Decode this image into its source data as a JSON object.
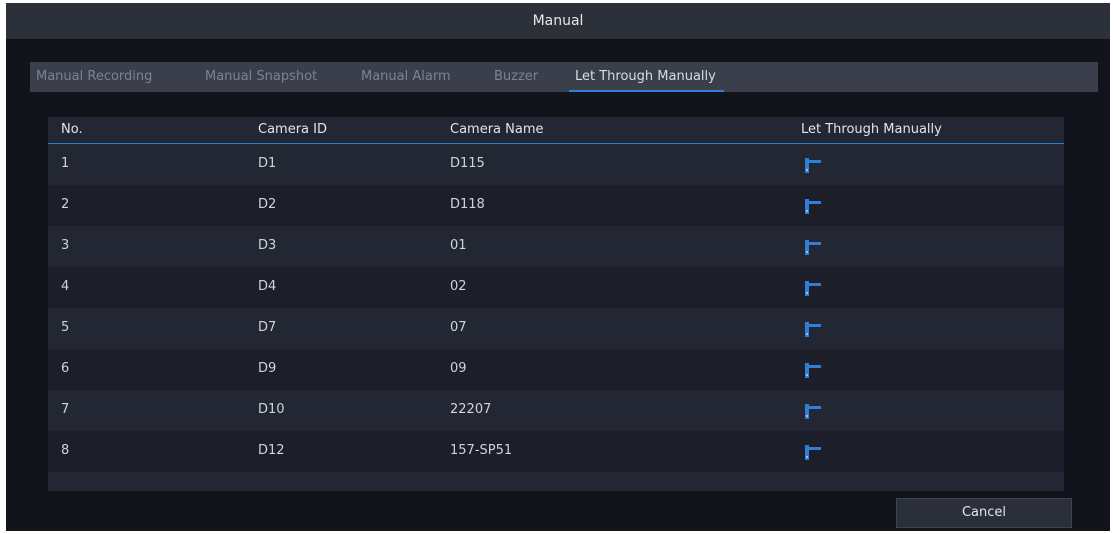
{
  "window": {
    "title": "Manual"
  },
  "tabs": [
    {
      "label": "Manual Recording"
    },
    {
      "label": "Manual Snapshot"
    },
    {
      "label": "Manual Alarm"
    },
    {
      "label": "Buzzer"
    },
    {
      "label": "Let Through Manually",
      "active": true
    }
  ],
  "table": {
    "headers": {
      "no": "No.",
      "camera_id": "Camera ID",
      "camera_name": "Camera Name",
      "action": "Let Through Manually"
    },
    "rows": [
      {
        "no": "1",
        "camera_id": "D1",
        "camera_name": "D115",
        "icon": "barrier-gate-icon"
      },
      {
        "no": "2",
        "camera_id": "D2",
        "camera_name": "D118",
        "icon": "barrier-gate-icon"
      },
      {
        "no": "3",
        "camera_id": "D3",
        "camera_name": "01",
        "icon": "barrier-gate-icon"
      },
      {
        "no": "4",
        "camera_id": "D4",
        "camera_name": "02",
        "icon": "barrier-gate-icon"
      },
      {
        "no": "5",
        "camera_id": "D7",
        "camera_name": "07",
        "icon": "barrier-gate-icon"
      },
      {
        "no": "6",
        "camera_id": "D9",
        "camera_name": "09",
        "icon": "barrier-gate-icon"
      },
      {
        "no": "7",
        "camera_id": "D10",
        "camera_name": "22207",
        "icon": "barrier-gate-icon"
      },
      {
        "no": "8",
        "camera_id": "D12",
        "camera_name": "157-SP51",
        "icon": "barrier-gate-icon"
      }
    ]
  },
  "footer": {
    "cancel_label": "Cancel"
  },
  "colors": {
    "accent": "#2f7fd6",
    "background": "#12141c",
    "table": "#232733"
  }
}
